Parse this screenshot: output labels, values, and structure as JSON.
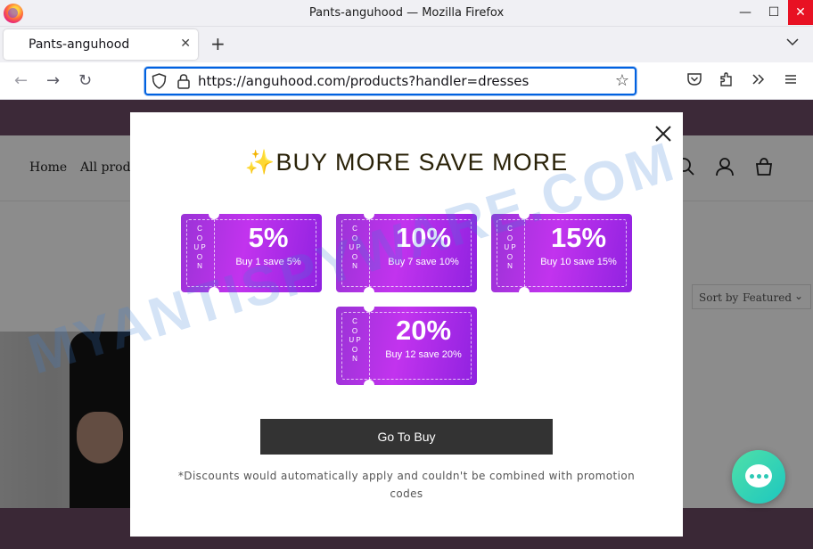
{
  "window": {
    "title": "Pants-anguhood — Mozilla Firefox",
    "minimize": "—",
    "maximize": "☐",
    "close": "✕"
  },
  "tabs": [
    {
      "label": "Pants-anguhood",
      "close": "✕"
    }
  ],
  "tabbar": {
    "new_tab": "+",
    "list_tabs": "⌄"
  },
  "navbar": {
    "back": "←",
    "forward": "→",
    "reload": "↻",
    "url": "https://anguhood.com/products?handler=dresses",
    "bookmark": "☆"
  },
  "site": {
    "nav": [
      "Home",
      "All produ"
    ],
    "sort_label": "Sort by",
    "sort_value": "Featured",
    "sort_chevron": "⌄"
  },
  "popup": {
    "close": "✕",
    "sparkle": "✨",
    "heading": "BUY MORE SAVE MORE",
    "coupon_side_label": "C O U P O N",
    "coupons": [
      {
        "percent": "5%",
        "desc": "Buy 1 save 5%"
      },
      {
        "percent": "10%",
        "desc": "Buy 7 save 10%"
      },
      {
        "percent": "15%",
        "desc": "Buy 10 save 15%"
      },
      {
        "percent": "20%",
        "desc": "Buy 12 save 20%"
      }
    ],
    "button": "Go To Buy",
    "disclaimer": "*Discounts would automatically apply and couldn't be combined with promotion codes"
  },
  "watermark": "MYANTISPYWARE.COM",
  "colors": {
    "coupon": "#b22ee8",
    "announce_bar": "#6e4b66",
    "button": "#333333",
    "chat": "#2cc9b5",
    "accent": "#0061e0"
  }
}
